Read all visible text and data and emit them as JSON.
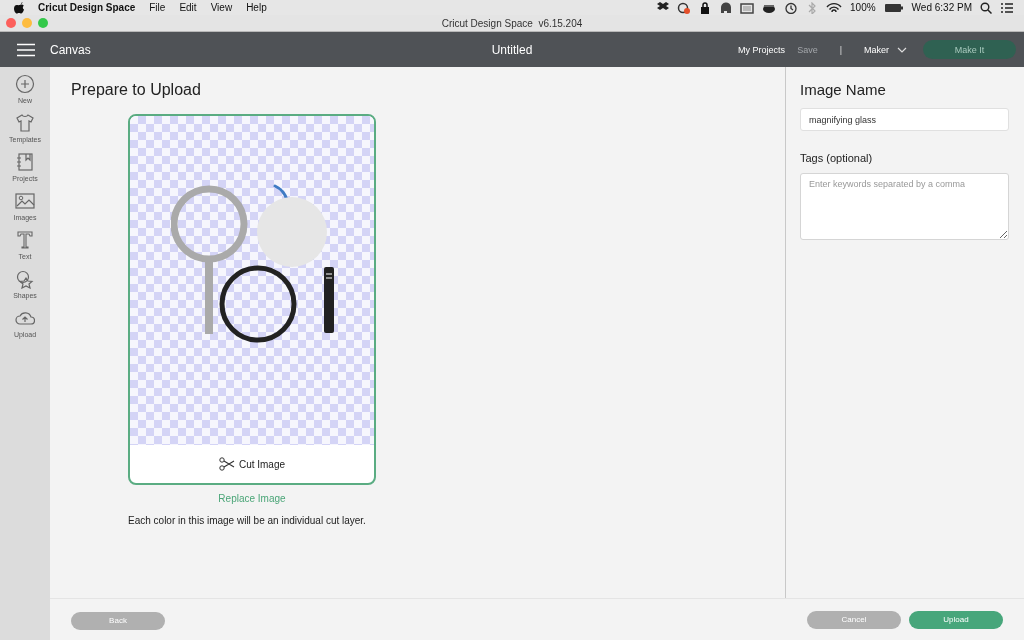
{
  "menu_bar": {
    "app": "Cricut Design Space",
    "menus": [
      "File",
      "Edit",
      "View",
      "Help"
    ],
    "battery": "100%",
    "clock": "Wed 6:32 PM"
  },
  "window": {
    "title": "Cricut Design Space  v6.15.204"
  },
  "header": {
    "section": "Canvas",
    "document": "Untitled",
    "links": [
      {
        "label": "My Projects",
        "disabled": false
      },
      {
        "label": "Save",
        "disabled": true
      }
    ],
    "separator": "|",
    "machine": "Maker",
    "make_it": {
      "label": "Make It",
      "disabled": true
    }
  },
  "sidebar": {
    "items": [
      {
        "label": "New"
      },
      {
        "label": "Templates"
      },
      {
        "label": "Projects"
      },
      {
        "label": "Images"
      },
      {
        "label": "Text"
      },
      {
        "label": "Shapes"
      },
      {
        "label": "Upload"
      }
    ]
  },
  "main": {
    "title": "Prepare to Upload",
    "cut_label": "Cut Image",
    "replace": "Replace Image",
    "note": "Each color in this image will be an individual cut layer."
  },
  "panel": {
    "name_label": "Image Name",
    "name_value": "magnifying glass",
    "tags_label": "Tags (optional)",
    "tags_placeholder": "Enter keywords separated by a comma"
  },
  "footer": {
    "buttons": [
      {
        "label": "Back",
        "kind": "secondary"
      },
      {
        "label": "Cancel",
        "kind": "secondary"
      },
      {
        "label": "Upload",
        "kind": "primary"
      }
    ]
  }
}
